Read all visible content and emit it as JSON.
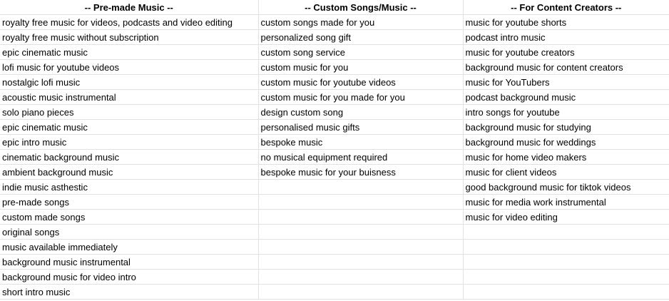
{
  "headers": [
    "-- Pre-made Music --",
    "-- Custom Songs/Music --",
    "-- For Content Creators --"
  ],
  "columns": [
    [
      "royalty free music for videos, podcasts and video editing",
      "royalty free music without subscription",
      "epic cinematic music",
      "lofi music for youtube videos",
      "nostalgic lofi music",
      "acoustic music instrumental",
      "solo piano pieces",
      "epic cinematic music",
      "epic intro music",
      "cinematic background music",
      "ambient background music",
      "indie music asthestic",
      "pre-made songs",
      "custom made songs",
      "original songs",
      "music available immediately",
      "background music instrumental",
      "background music for video intro",
      "short intro music"
    ],
    [
      "custom songs made for you",
      "personalized song gift",
      "custom song service",
      "custom music for you",
      "custom music for youtube videos",
      "custom music for you made for you",
      "design custom song",
      "personalised music gifts",
      "bespoke music",
      "no musical equipment required",
      "bespoke music for your buisness",
      "",
      "",
      "",
      "",
      "",
      "",
      "",
      ""
    ],
    [
      "music for youtube shorts",
      "podcast intro music",
      "music for youtube creators",
      "background music for content creators",
      "music for YouTubers",
      "podcast background music",
      "intro songs for youtube",
      "background music for studying",
      "background music for weddings",
      "music for home video makers",
      "music for client videos",
      "good background music for tiktok videos",
      "music for media work instrumental",
      "music for video editing",
      "",
      "",
      "",
      "",
      ""
    ]
  ]
}
